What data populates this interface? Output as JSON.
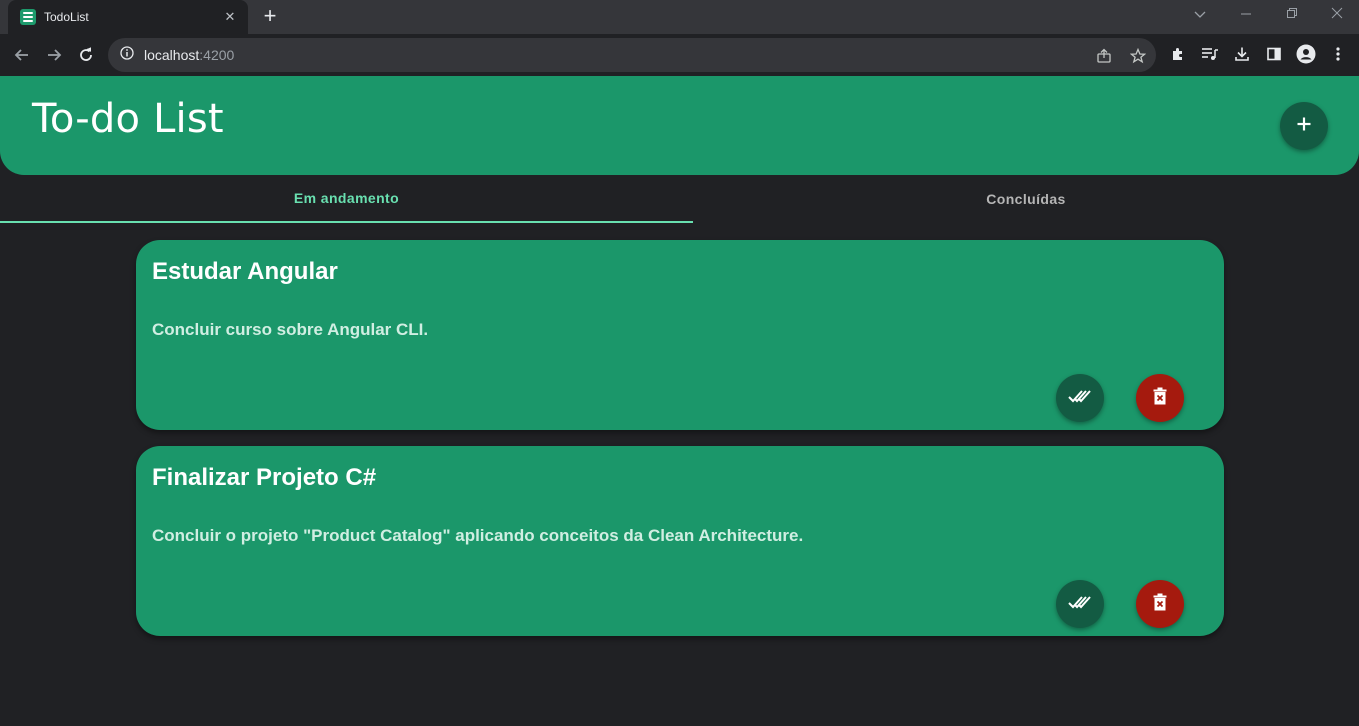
{
  "browser": {
    "tab_title": "TodoList",
    "url_host": "localhost",
    "url_port": ":4200"
  },
  "app": {
    "title": "To-do List"
  },
  "tabs": [
    {
      "label": "Em andamento",
      "active": true
    },
    {
      "label": "Concluídas",
      "active": false
    }
  ],
  "tasks": [
    {
      "title": "Estudar Angular",
      "description": "Concluir curso sobre Angular CLI."
    },
    {
      "title": "Finalizar Projeto C#",
      "description": "Concluir o projeto \"Product Catalog\" aplicando conceitos da Clean Architecture."
    }
  ],
  "colors": {
    "primary": "#1b976a",
    "primary_dark": "#135b43",
    "accent_tab": "#69e0b0",
    "delete": "#a51a0e",
    "background": "#202124"
  },
  "icons": {
    "add": "plus-icon",
    "done": "done-all-icon",
    "delete": "delete-forever-icon"
  }
}
